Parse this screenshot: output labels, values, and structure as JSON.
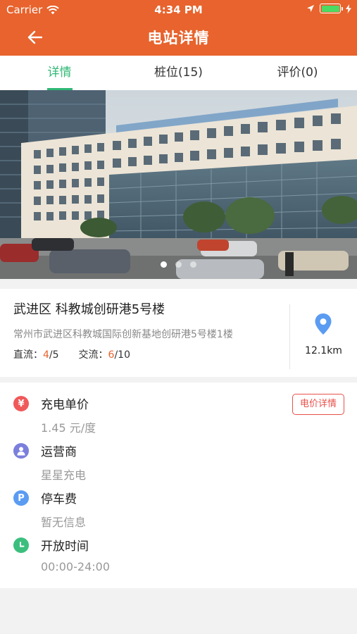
{
  "status_bar": {
    "carrier": "Carrier",
    "time": "4:34 PM"
  },
  "nav": {
    "title": "电站详情"
  },
  "tabs": [
    {
      "label": "详情",
      "active": true
    },
    {
      "label": "桩位(15)",
      "active": false
    },
    {
      "label": "评价(0)",
      "active": false
    }
  ],
  "banner": {
    "pages": 3,
    "current_page": 1
  },
  "station": {
    "name": "武进区 科教城创研港5号楼",
    "address": "常州市武进区科教城国际创新基地创研港5号楼1楼",
    "dc_label": "直流：",
    "dc_available": "4",
    "dc_total": "/5",
    "ac_label": "交流：",
    "ac_available": "6",
    "ac_total": "/10",
    "distance": "12.1km"
  },
  "info": {
    "price_label": "充电单价",
    "price_value": "1.45 元/度",
    "price_button": "电价详情",
    "operator_label": "运营商",
    "operator_value": "星星充电",
    "parking_label": "停车费",
    "parking_value": "暂无信息",
    "hours_label": "开放时间",
    "hours_value": "00:00-24:00"
  },
  "colors": {
    "header": "#e8632d",
    "tab_active": "#2fb874",
    "price_icon": "#f0595a",
    "operator_icon": "#7b7fdc",
    "parking_icon": "#5b9cf2",
    "hours_icon": "#3cbf7d",
    "pin": "#5b9cf2"
  },
  "icons": {
    "price": "yen-icon",
    "operator": "person-icon",
    "parking": "parking-icon",
    "hours": "clock-icon"
  }
}
